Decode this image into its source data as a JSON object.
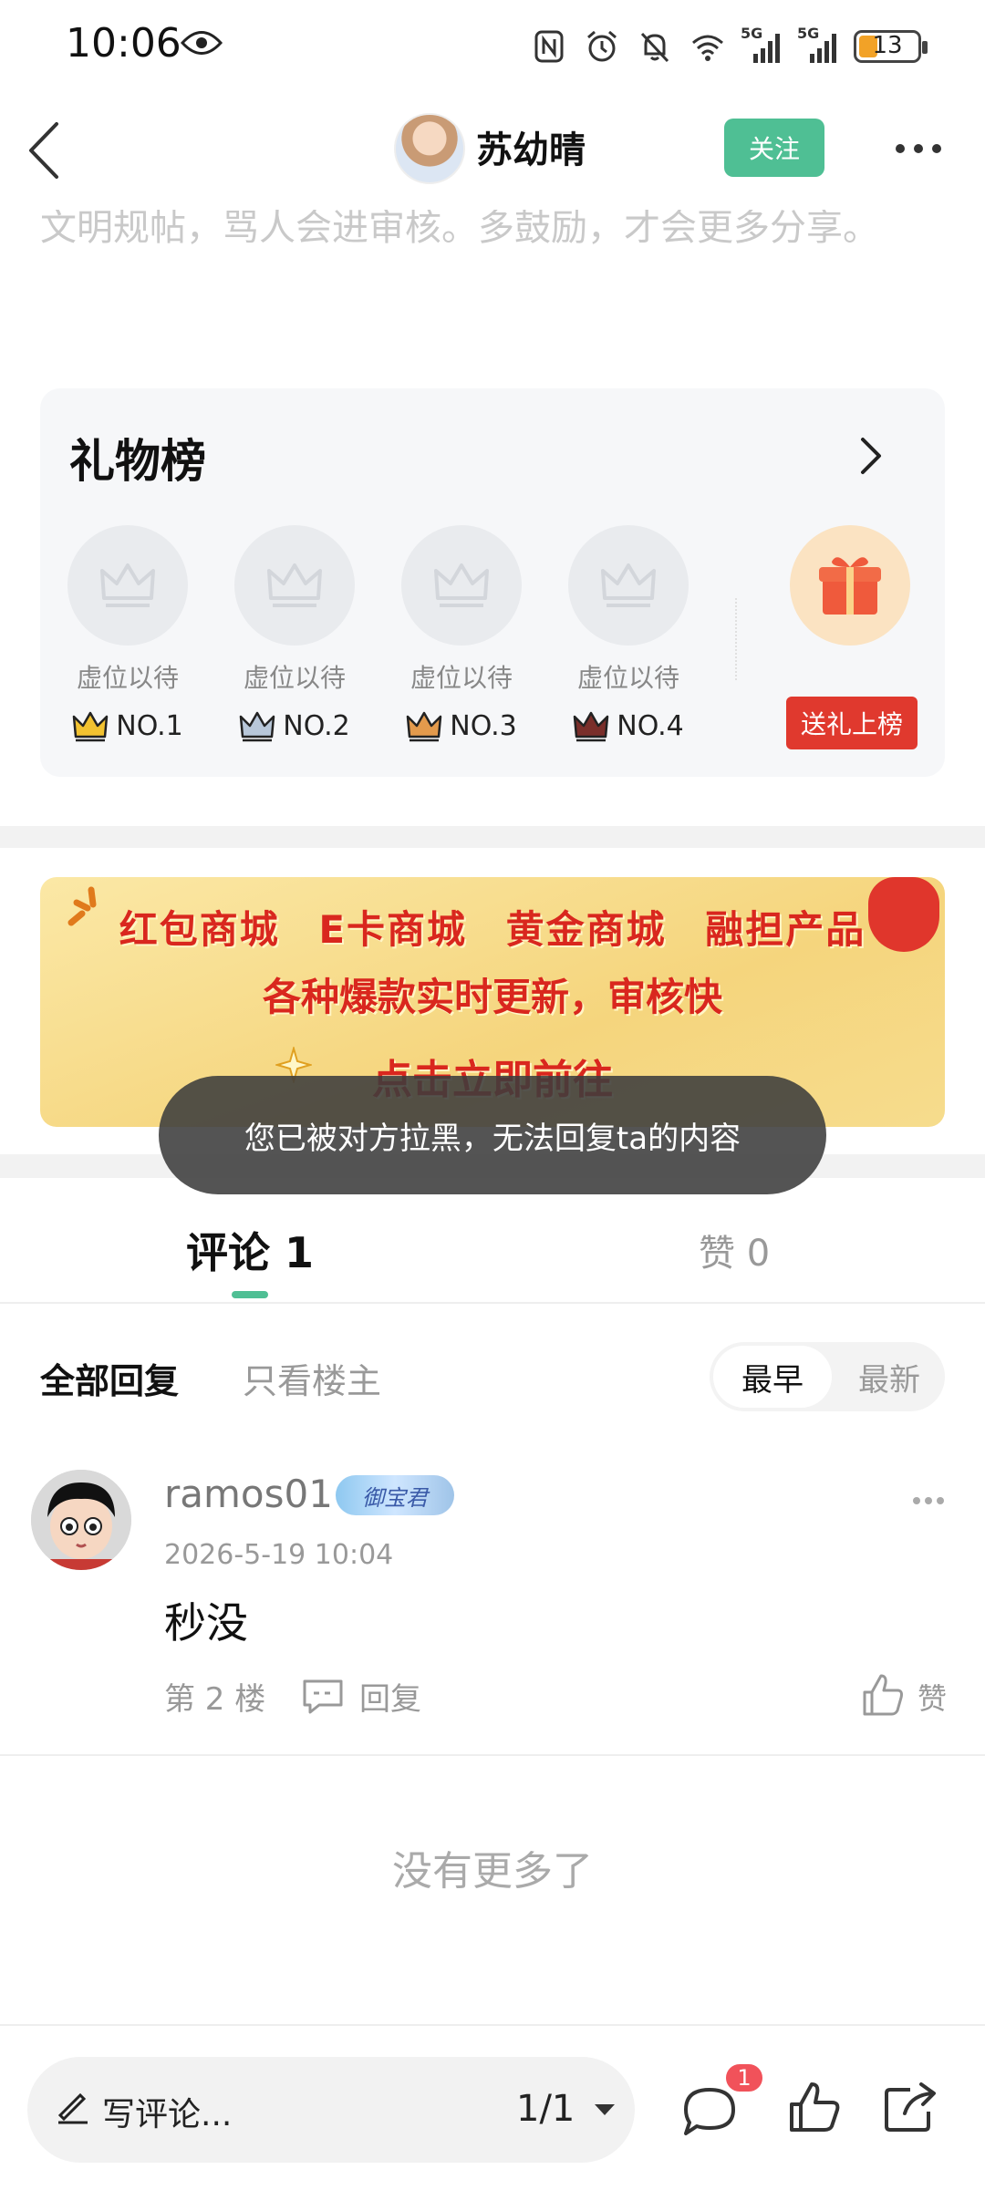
{
  "status_bar": {
    "time": "10:06",
    "battery": "13",
    "net1": "5G",
    "net2": "5G"
  },
  "header": {
    "username": "苏幼晴",
    "follow_label": "关注"
  },
  "post": {
    "tail_text": "文明规帖，骂人会进审核。多鼓励，才会更多分享。"
  },
  "gift_board": {
    "title": "礼物榜",
    "slots": [
      {
        "label": "虚位以待",
        "rank": "NO.1",
        "crown_color": "#f2c230"
      },
      {
        "label": "虚位以待",
        "rank": "NO.2",
        "crown_color": "#b8c7d9"
      },
      {
        "label": "虚位以待",
        "rank": "NO.3",
        "crown_color": "#e39a4c"
      },
      {
        "label": "虚位以待",
        "rank": "NO.4",
        "crown_color": "#7a2e2a"
      }
    ],
    "send_label": "送礼上榜"
  },
  "banner": {
    "line1": "红包商城 E卡商城 黄金商城 融担产品",
    "line2": "各种爆款实时更新，审核快",
    "line3": "点击立即前往"
  },
  "toast": {
    "message": "您已被对方拉黑，无法回复ta的内容"
  },
  "tabs": {
    "comments": "评论 1",
    "likes": "赞 0"
  },
  "filters": {
    "all": "全部回复",
    "owner_only": "只看楼主",
    "sort_earliest": "最早",
    "sort_newest": "最新"
  },
  "comments": [
    {
      "username": "ramos01",
      "badge": "御宝君",
      "time": "2026-5-19 10:04",
      "text": "秒没",
      "floor": "第 2 楼",
      "reply_label": "回复",
      "like_label": "赞"
    }
  ],
  "footer_text": "没有更多了",
  "bottom_bar": {
    "write_placeholder": "写评论...",
    "page_indicator": "1/1",
    "comment_badge": "1"
  },
  "colors": {
    "accent_green": "#4fbf94",
    "send_red": "#e0392e",
    "banner_red": "#d9271e"
  }
}
